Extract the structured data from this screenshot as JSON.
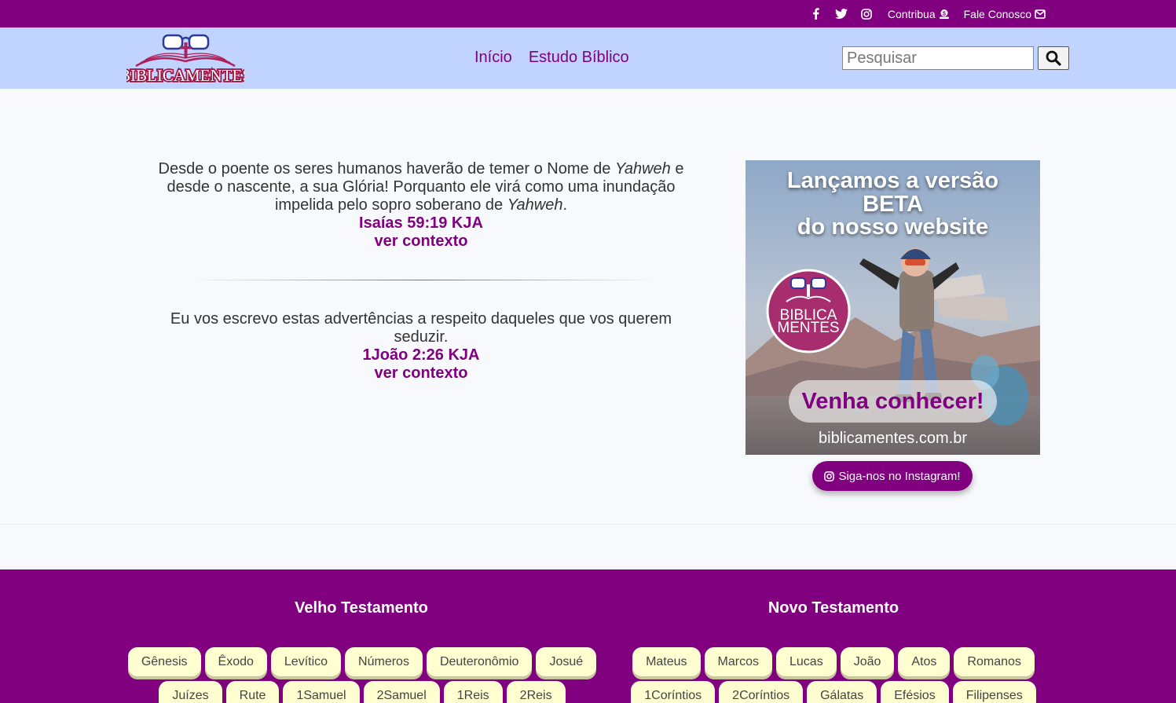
{
  "topbar": {
    "social": [
      "facebook-icon",
      "twitter-icon",
      "instagram-icon"
    ],
    "contribute_label": "Contribua",
    "contact_label": "Fale Conosco"
  },
  "header": {
    "logo_text": "BIBLICAMENTES",
    "nav": [
      "Início",
      "Estudo Bíblico"
    ],
    "search_placeholder": "Pesquisar"
  },
  "verses": [
    {
      "text_before": "Desde o poente os seres humanos haverão de temer o Nome de ",
      "em1": "Yahweh",
      "text_middle": " e desde o nascente, a sua Glória! Porquanto ele virá como uma inundação impelida pelo sopro soberano de ",
      "em2": "Yahweh",
      "text_after": ".",
      "reference": "Isaías 59:19 KJA",
      "context_label": "ver contexto"
    },
    {
      "text": "Eu vos escrevo estas advertências a respeito daqueles que vos querem seduzir.",
      "reference": "1João 2:26 KJA",
      "context_label": "ver contexto"
    }
  ],
  "banner": {
    "line1": "Lançamos a versão",
    "line2": "BETA",
    "line3": "do nosso website",
    "logo_line1": "BIBLICA",
    "logo_line2": "MENTES",
    "cta": "Venha conhecer!",
    "url": "biblicamentes.com.br"
  },
  "instagram_button": "Siga-nos no Instagram!",
  "footer": {
    "old_title": "Velho Testamento",
    "new_title": "Novo Testamento",
    "old_books": [
      "Gênesis",
      "Êxodo",
      "Levítico",
      "Números",
      "Deuteronômio",
      "Josué",
      "Juízes",
      "Rute",
      "1Samuel",
      "2Samuel",
      "1Reis",
      "2Reis"
    ],
    "new_books": [
      "Mateus",
      "Marcos",
      "Lucas",
      "João",
      "Atos",
      "Romanos",
      "1Coríntios",
      "2Coríntios",
      "Gálatas",
      "Efésios",
      "Filipenses"
    ]
  },
  "colors": {
    "brand_purple": "#800080",
    "header_blue": "#c1d3ff",
    "book_pill": "#fffed1"
  }
}
